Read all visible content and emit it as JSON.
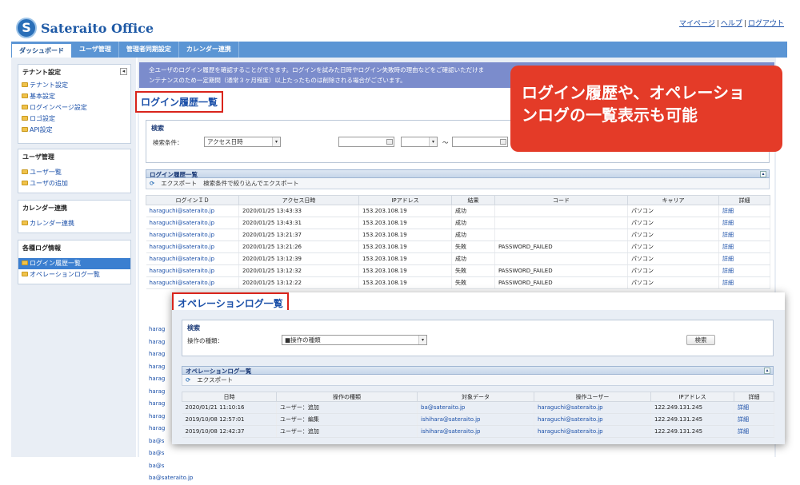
{
  "header": {
    "logo_text": "Sateraito Office",
    "logo_mark": "S",
    "links": [
      "マイページ",
      "ヘルプ",
      "ログアウト"
    ]
  },
  "tabs": [
    "ダッシュボード",
    "ユーザ管理",
    "管理者同期設定",
    "カレンダー連携"
  ],
  "sidebar": {
    "sections": [
      {
        "title": "テナント設定",
        "items": [
          "テナント設定",
          "基本設定",
          "ログインページ設定",
          "ロゴ設定",
          "API設定"
        ]
      },
      {
        "title": "ユーザ管理",
        "items": [
          "ユーザ一覧",
          "ユーザの追加"
        ]
      },
      {
        "title": "カレンダー連携",
        "items": [
          "カレンダー連携"
        ]
      },
      {
        "title": "各種ログ情報",
        "items": [
          "ログイン履歴一覧",
          "オペレーションログ一覧"
        ]
      }
    ]
  },
  "notice": {
    "line1": "全ユーザのログイン履歴を確認することができます。ログインを試みた日時やログイン失敗時の理由などをご確認いただけま",
    "line2": "ンテナンスのため一定期間（通常３ヶ月程度）以上たったものは削除される場合がございます。"
  },
  "login_history": {
    "title": "ログイン履歴一覧",
    "search": {
      "heading": "検索",
      "condition_label": "検索条件：",
      "condition_value": "アクセス日時",
      "tilde": "〜"
    },
    "grid_title": "ログイン履歴一覧",
    "toolbar": [
      "エクスポート",
      "検索条件で絞り込んでエクスポート"
    ],
    "columns": [
      "ログインＩＤ",
      "アクセス日時",
      "IPアドレス",
      "結果",
      "コード",
      "キャリア",
      "詳細"
    ],
    "rows": [
      [
        "haraguchi@sateraito.jp",
        "2020/01/25 13:43:33",
        "153.203.108.19",
        "成功",
        "",
        "パソコン",
        "詳細"
      ],
      [
        "haraguchi@sateraito.jp",
        "2020/01/25 13:43:31",
        "153.203.108.19",
        "成功",
        "",
        "パソコン",
        "詳細"
      ],
      [
        "haraguchi@sateraito.jp",
        "2020/01/25 13:21:37",
        "153.203.108.19",
        "成功",
        "",
        "パソコン",
        "詳細"
      ],
      [
        "haraguchi@sateraito.jp",
        "2020/01/25 13:21:26",
        "153.203.108.19",
        "失敗",
        "PASSWORD_FAILED",
        "パソコン",
        "詳細"
      ],
      [
        "haraguchi@sateraito.jp",
        "2020/01/25 13:12:39",
        "153.203.108.19",
        "成功",
        "",
        "パソコン",
        "詳細"
      ],
      [
        "haraguchi@sateraito.jp",
        "2020/01/25 13:12:32",
        "153.203.108.19",
        "失敗",
        "PASSWORD_FAILED",
        "パソコン",
        "詳細"
      ],
      [
        "haraguchi@sateraito.jp",
        "2020/01/25 13:12:22",
        "153.203.108.19",
        "失敗",
        "PASSWORD_FAILED",
        "パソコン",
        "詳細"
      ]
    ],
    "hidden_rows_prefix": [
      "harag",
      "harag",
      "harag",
      "harag",
      "harag",
      "harag",
      "harag",
      "harag",
      "harag",
      "ba@s",
      "ba@s",
      "ba@s",
      "ba@sateraito.jp"
    ]
  },
  "operation_log": {
    "title": "オペレーションログ一覧",
    "search": {
      "heading": "検索",
      "type_label": "操作の種類：",
      "type_value": "■操作の種類",
      "search_button": "検索"
    },
    "grid_title": "オペレーションログ一覧",
    "toolbar": [
      "エクスポート"
    ],
    "columns": [
      "日時",
      "操作の種類",
      "対象データ",
      "操作ユーザー",
      "IPアドレス",
      "詳細"
    ],
    "rows": [
      [
        "2020/01/21 11:10:16",
        "ユーザー：追加",
        "ba@sateraito.jp",
        "haraguchi@sateraito.jp",
        "122.249.131.245",
        "詳細"
      ],
      [
        "2019/10/08 12:57:01",
        "ユーザー：編集",
        "ishihara@sateraito.jp",
        "haraguchi@sateraito.jp",
        "122.249.131.245",
        "詳細"
      ],
      [
        "2019/10/08 12:42:37",
        "ユーザー：追加",
        "ishihara@sateraito.jp",
        "haraguchi@sateraito.jp",
        "122.249.131.245",
        "詳細"
      ]
    ]
  },
  "callout": {
    "line1": "ログイン履歴や、オペレーショ",
    "line2": "ンログの一覧表示も可能"
  },
  "colors": {
    "accent": "#5b95d4",
    "callout": "#e43b28",
    "highlight_border": "#d9241b"
  }
}
